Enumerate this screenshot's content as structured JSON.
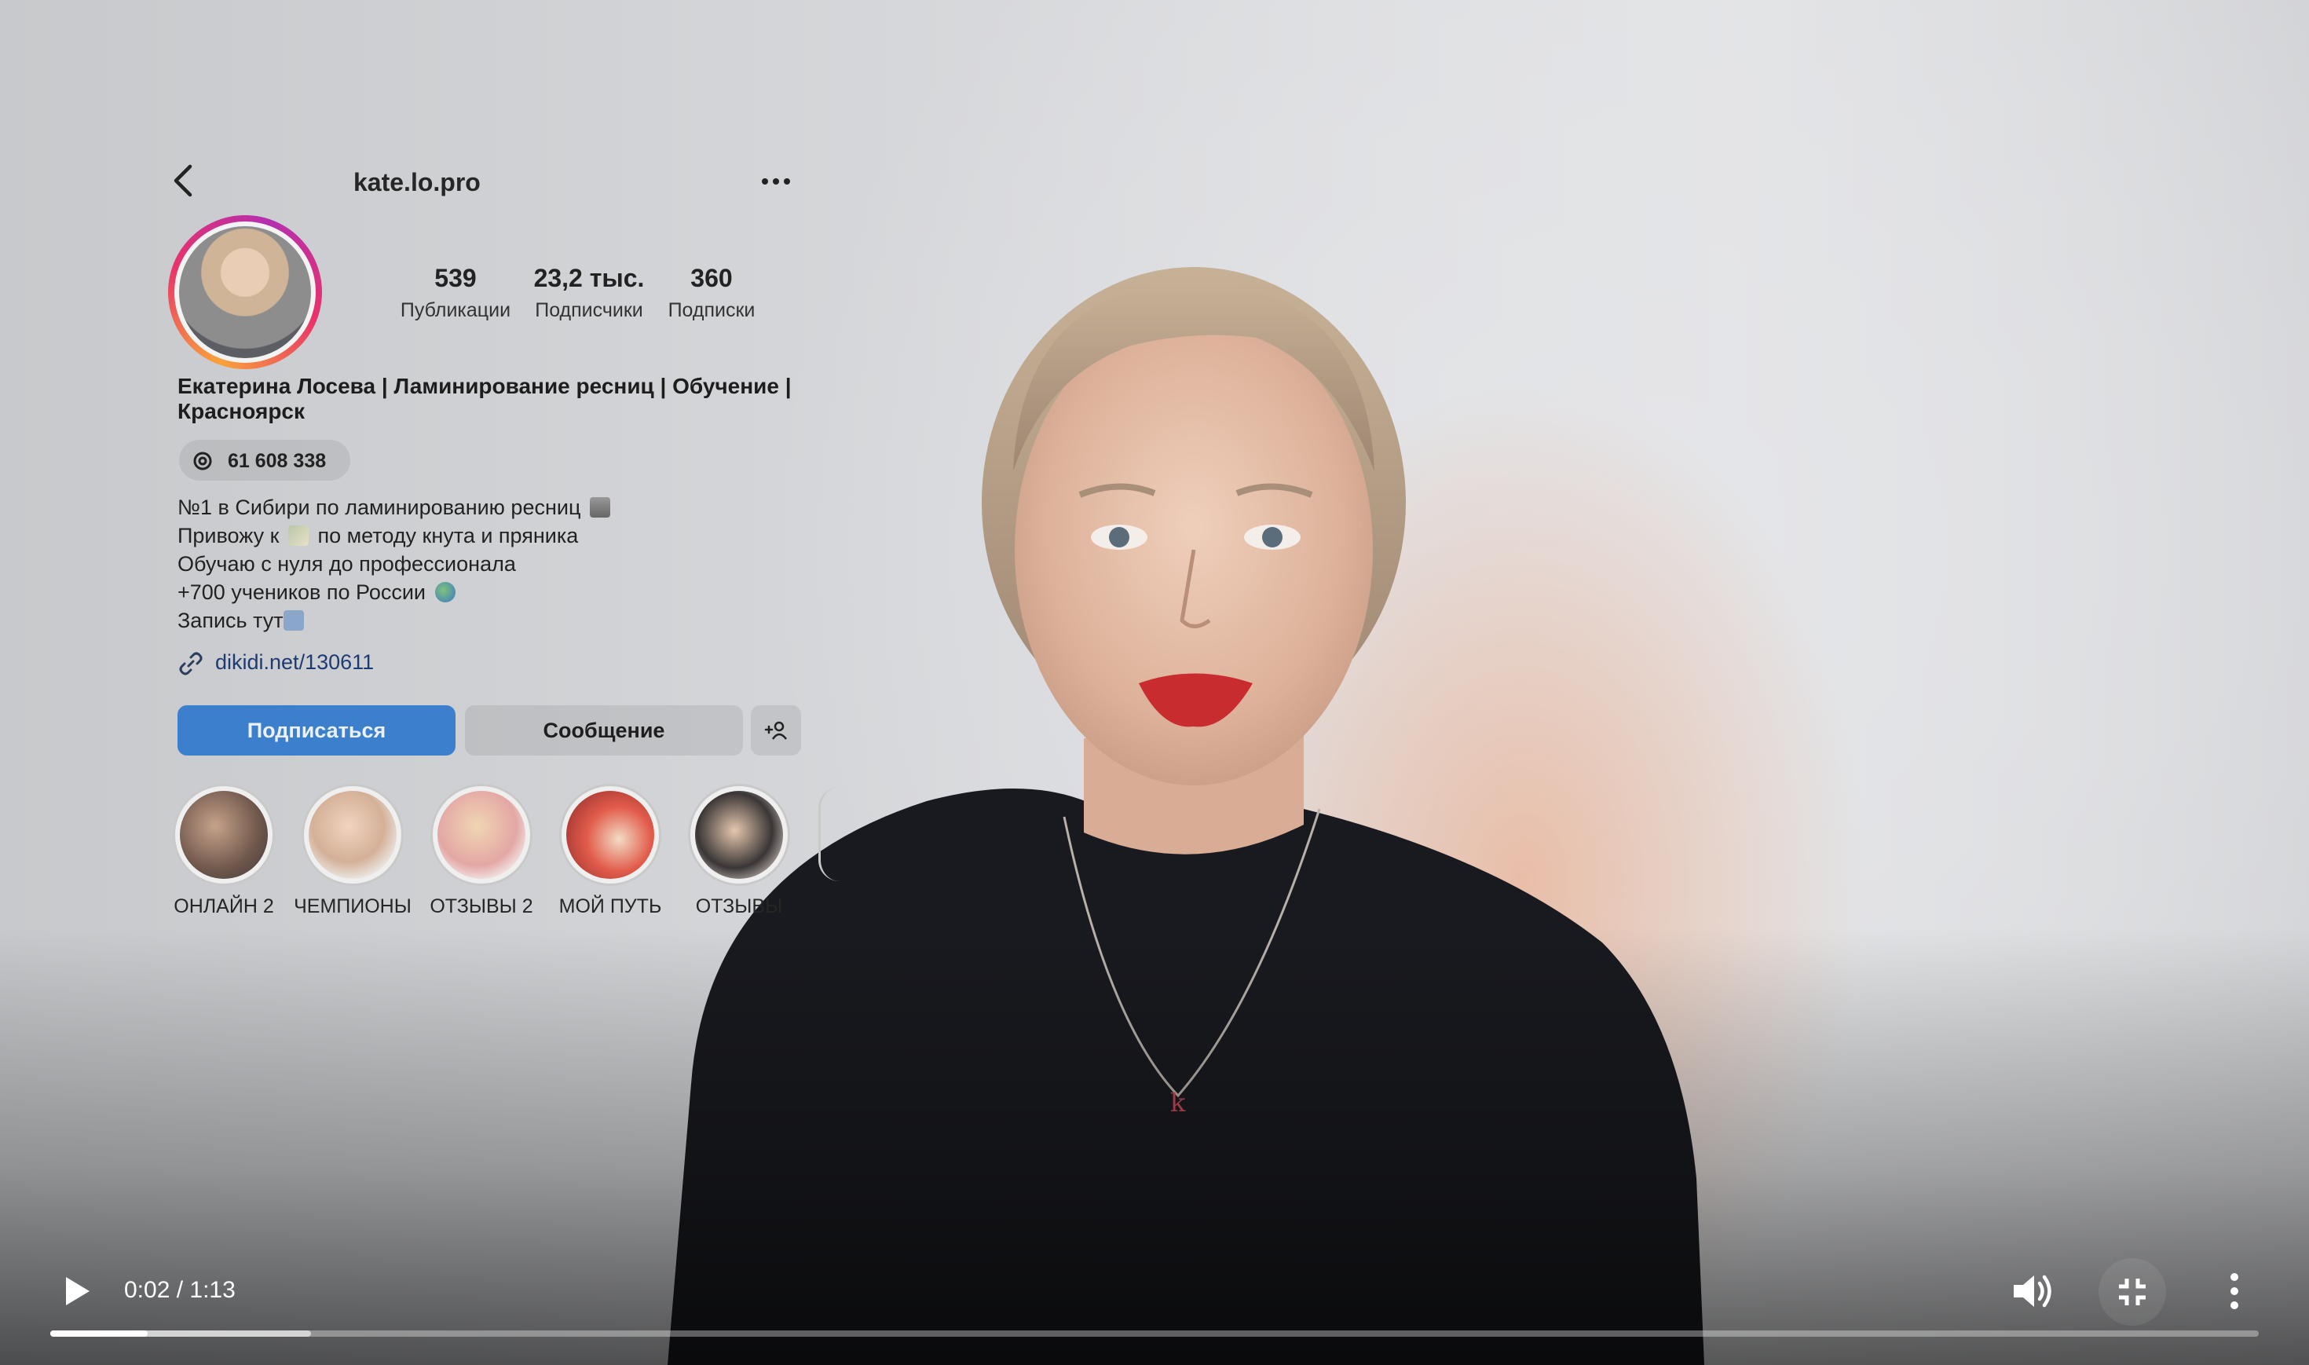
{
  "profile": {
    "username": "kate.lo.pro",
    "stats": [
      {
        "value": "539",
        "label": "Публикации"
      },
      {
        "value": "23,2 тыс.",
        "label": "Подписчики"
      },
      {
        "value": "360",
        "label": "Подписки"
      }
    ],
    "full_name": "Екатерина Лосева | Ламинирование ресниц | Обучение | Красноярск",
    "threads_count": "61 608 338",
    "bio": [
      "№1 в Сибири по ламинированию ресниц",
      "Привожу к",
      "по методу кнута и пряника",
      "Обучаю с нуля до профессионала",
      "+700 учеников по России",
      "Запись тут"
    ],
    "link": "dikidi.net/130611",
    "buttons": {
      "follow": "Подписаться",
      "message": "Сообщение"
    },
    "highlights": [
      {
        "label": "ОНЛАЙН 2"
      },
      {
        "label": "ЧЕМПИОНЫ"
      },
      {
        "label": "ОТЗЫВЫ 2"
      },
      {
        "label": "МОЙ ПУТЬ"
      },
      {
        "label": "ОТЗЫВЫ"
      }
    ],
    "colors": {
      "follow_button": "#3c7fcd",
      "link": "#1d3b73"
    }
  },
  "player": {
    "time": "0:02 / 1:13",
    "progress_played": 0.044,
    "progress_buffered": 0.118,
    "icons": [
      "play-icon",
      "volume-icon",
      "exit-fullscreen-icon",
      "more-vertical-icon"
    ]
  }
}
